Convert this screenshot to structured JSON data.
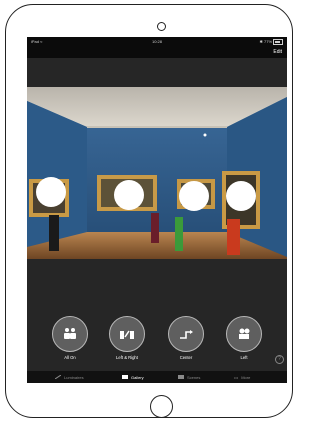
{
  "status_bar": {
    "carrier": "iPad ≈",
    "time": "10:28",
    "battery": "✱ 77%"
  },
  "nav": {
    "edit_label": "Edit"
  },
  "modes": [
    {
      "label": "All On",
      "icon": "people-group-icon"
    },
    {
      "label": "Left & Right",
      "icon": "split-speakers-icon"
    },
    {
      "label": "Center",
      "icon": "center-arrow-icon"
    },
    {
      "label": "Left",
      "icon": "camera-left-icon"
    }
  ],
  "tabs": [
    {
      "label": "Luminaires",
      "icon": "lamp-icon",
      "active": false
    },
    {
      "label": "Gallery",
      "icon": "gallery-icon",
      "active": true
    },
    {
      "label": "Scenes",
      "icon": "scenes-icon",
      "active": false
    },
    {
      "label": "More",
      "icon": "more-icon",
      "active": false
    }
  ],
  "colors": {
    "accent": "#ffffff",
    "wall": "#2f5b86",
    "floor": "#9b6a3c"
  }
}
